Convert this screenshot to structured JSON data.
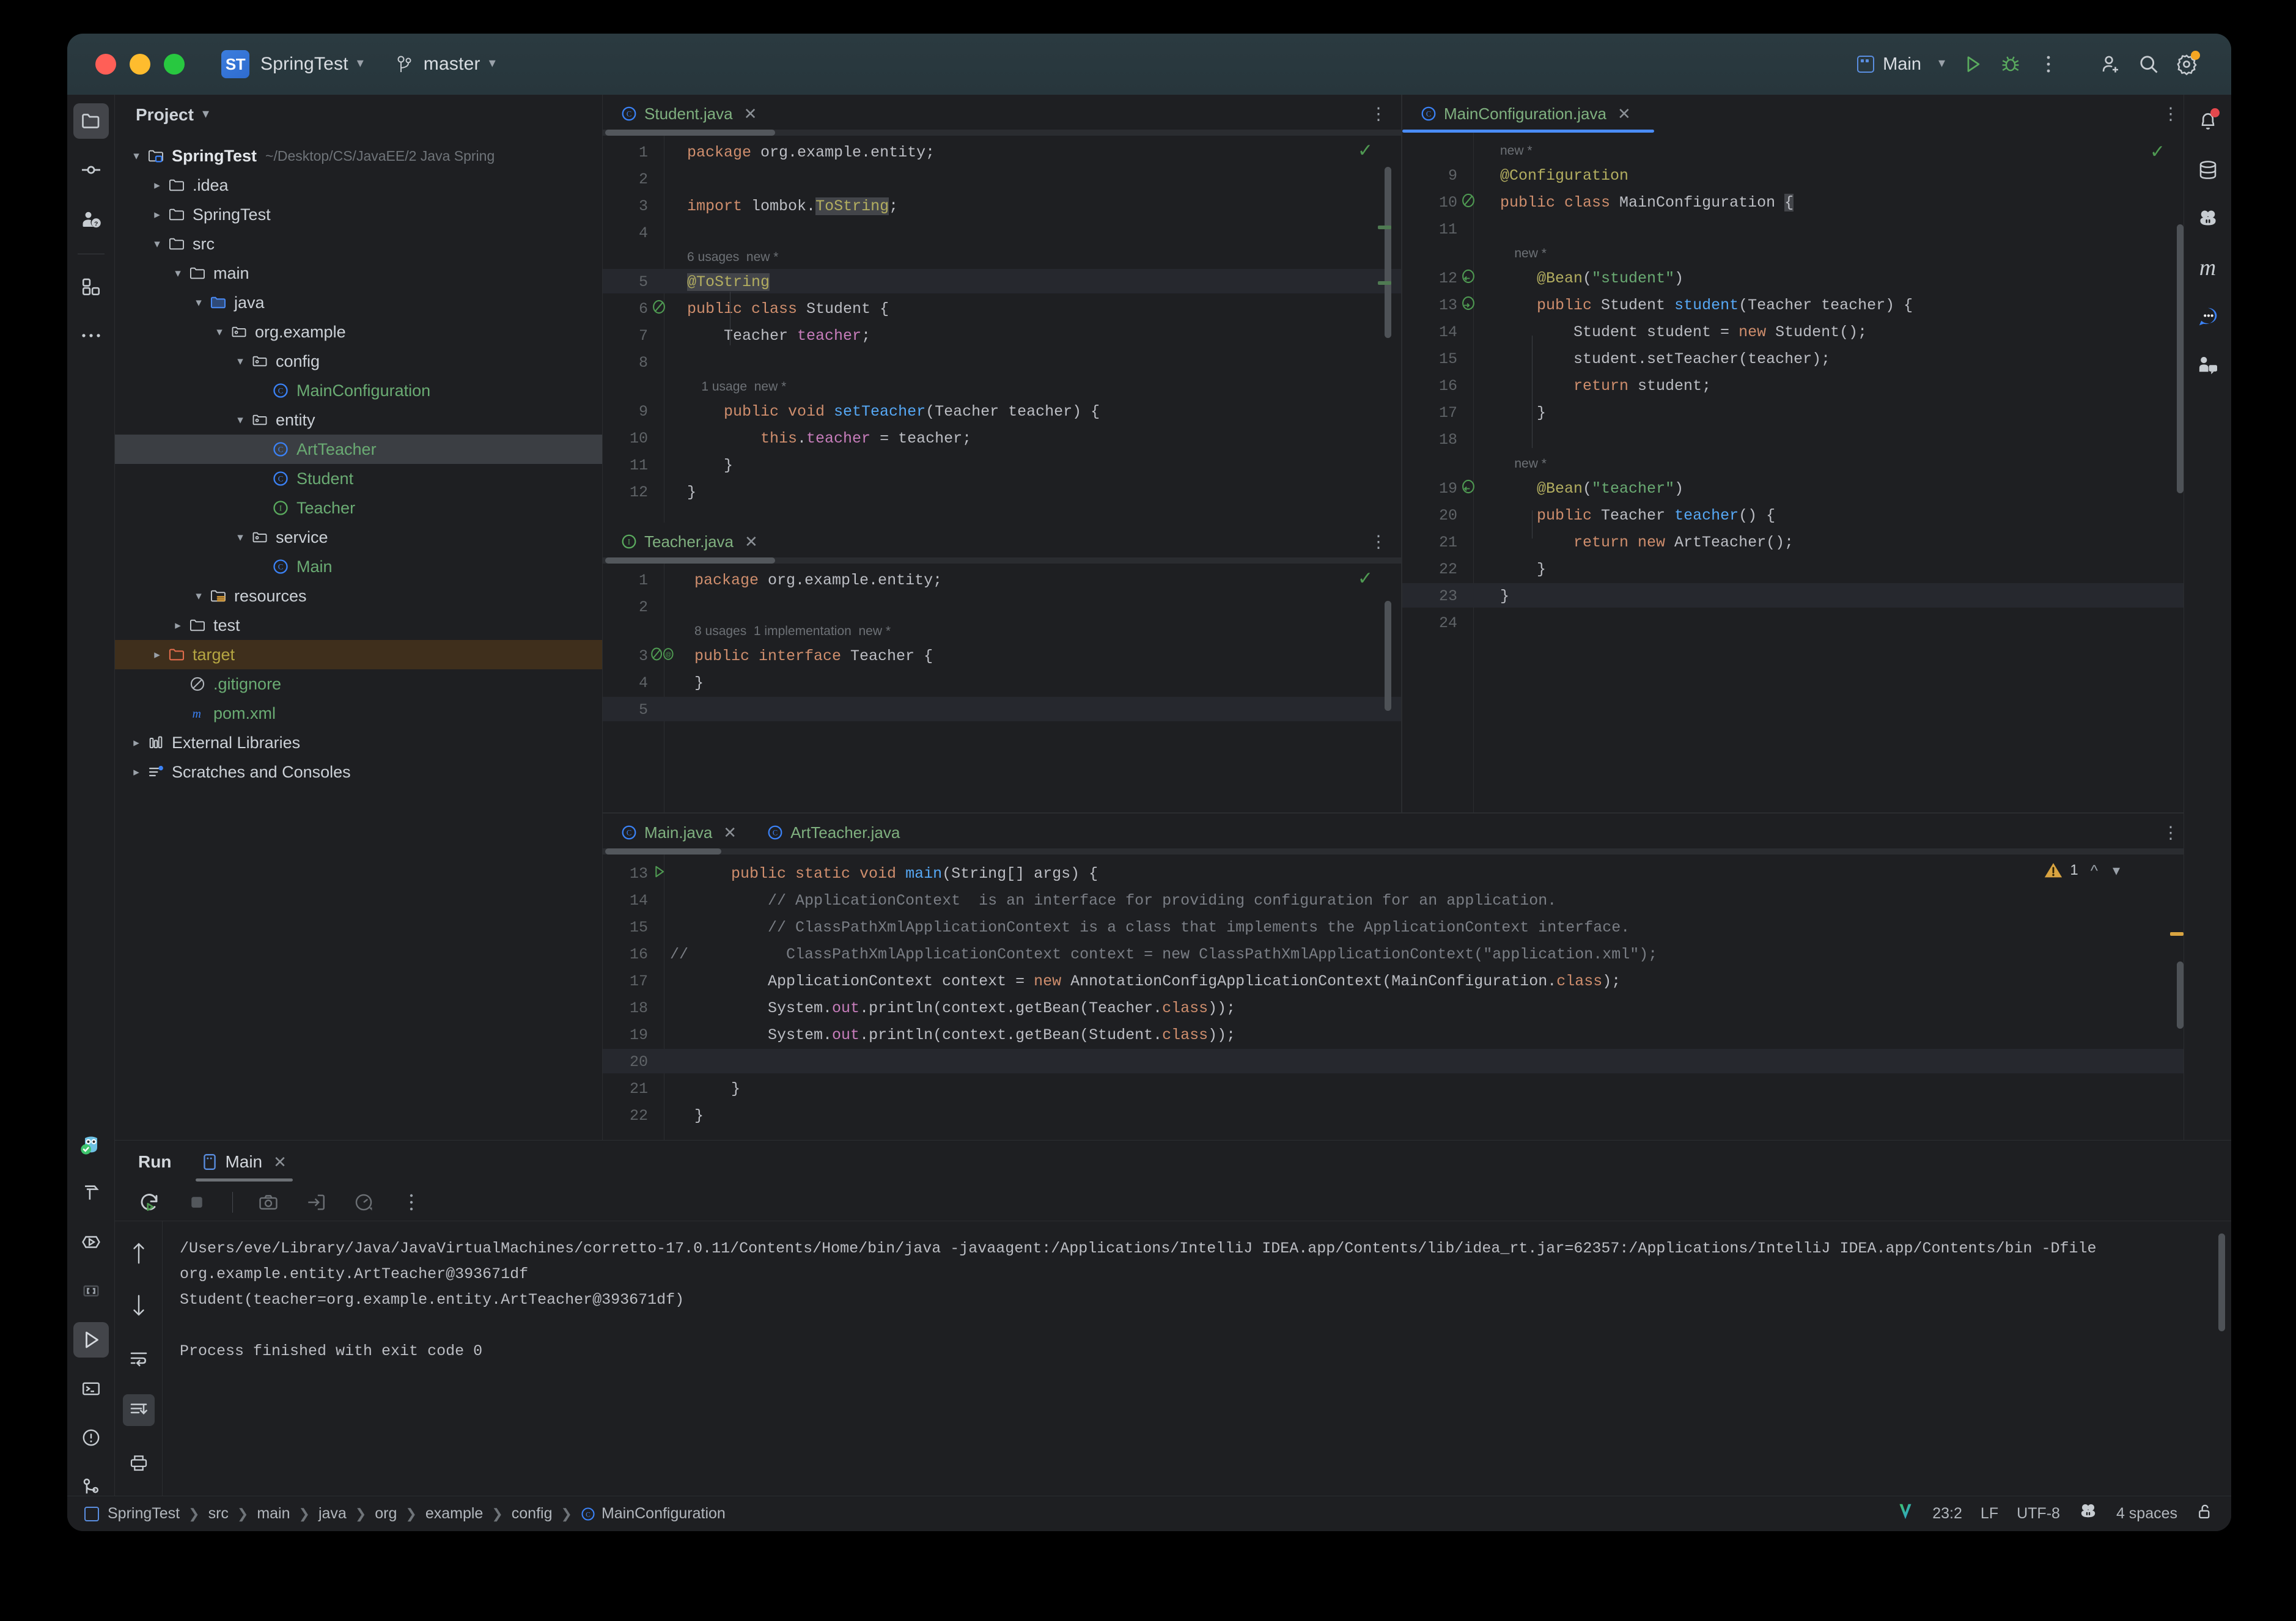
{
  "titlebar": {
    "project_badge": "ST",
    "project_name": "SpringTest",
    "branch": "master",
    "run_config": "Main",
    "icons": [
      "run-icon",
      "debug-icon",
      "more-options-icon",
      "add-user-icon",
      "search-icon",
      "settings-icon"
    ]
  },
  "project_panel": {
    "title": "Project",
    "tree": [
      {
        "label": "SpringTest",
        "path": "~/Desktop/CS/JavaEE/2 Java Spring",
        "depth": 0,
        "arrow": "down",
        "icon": "module-folder-icon",
        "style": "bold"
      },
      {
        "label": ".idea",
        "depth": 1,
        "arrow": "right",
        "icon": "folder-icon",
        "style": ""
      },
      {
        "label": "SpringTest",
        "depth": 1,
        "arrow": "right",
        "icon": "folder-icon",
        "style": ""
      },
      {
        "label": "src",
        "depth": 1,
        "arrow": "down",
        "icon": "folder-icon",
        "style": ""
      },
      {
        "label": "main",
        "depth": 2,
        "arrow": "down",
        "icon": "folder-icon",
        "style": ""
      },
      {
        "label": "java",
        "depth": 3,
        "arrow": "down",
        "icon": "source-folder-icon",
        "style": ""
      },
      {
        "label": "org.example",
        "depth": 4,
        "arrow": "down",
        "icon": "package-icon",
        "style": ""
      },
      {
        "label": "config",
        "depth": 5,
        "arrow": "down",
        "icon": "package-icon",
        "style": ""
      },
      {
        "label": "MainConfiguration",
        "depth": 6,
        "arrow": "",
        "icon": "class-icon",
        "style": "green"
      },
      {
        "label": "entity",
        "depth": 5,
        "arrow": "down",
        "icon": "package-icon",
        "style": ""
      },
      {
        "label": "ArtTeacher",
        "depth": 6,
        "arrow": "",
        "icon": "class-icon",
        "style": "green",
        "selected": true
      },
      {
        "label": "Student",
        "depth": 6,
        "arrow": "",
        "icon": "class-icon",
        "style": "green"
      },
      {
        "label": "Teacher",
        "depth": 6,
        "arrow": "",
        "icon": "interface-icon",
        "style": "green"
      },
      {
        "label": "service",
        "depth": 5,
        "arrow": "down",
        "icon": "package-icon",
        "style": ""
      },
      {
        "label": "Main",
        "depth": 6,
        "arrow": "",
        "icon": "class-icon",
        "style": "green"
      },
      {
        "label": "resources",
        "depth": 3,
        "arrow": "down",
        "icon": "resources-folder-icon",
        "style": ""
      },
      {
        "label": "test",
        "depth": 2,
        "arrow": "right",
        "icon": "folder-icon",
        "style": ""
      },
      {
        "label": "target",
        "depth": 1,
        "arrow": "right",
        "icon": "excluded-folder-icon",
        "style": "olive",
        "highlighted": true
      },
      {
        "label": ".gitignore",
        "depth": 2,
        "arrow": "",
        "icon": "gitignore-icon",
        "style": "green"
      },
      {
        "label": "pom.xml",
        "depth": 2,
        "arrow": "",
        "icon": "maven-icon",
        "style": "green"
      },
      {
        "label": "External Libraries",
        "depth": 0,
        "arrow": "right",
        "icon": "library-icon",
        "style": ""
      },
      {
        "label": "Scratches and Consoles",
        "depth": 0,
        "arrow": "right",
        "icon": "scratches-icon",
        "style": ""
      }
    ]
  },
  "editors": {
    "student": {
      "tab": {
        "label": "Student.java",
        "icon": "class-icon",
        "closable": true
      },
      "lines": [
        {
          "n": "1",
          "segments": [
            {
              "t": "package ",
              "c": "k-kw"
            },
            {
              "t": "org.example.entity;",
              "c": "k-txt"
            }
          ]
        },
        {
          "n": "2",
          "segments": []
        },
        {
          "n": "3",
          "segments": [
            {
              "t": "import ",
              "c": "k-kw"
            },
            {
              "t": "lombok.",
              "c": "k-txt"
            },
            {
              "t": "ToString",
              "c": "k-anno k-hl"
            },
            {
              "t": ";",
              "c": "k-txt"
            }
          ]
        },
        {
          "n": "4",
          "segments": []
        },
        {
          "n": "5",
          "segments": [
            {
              "t": "@ToString",
              "c": "k-anno k-hl"
            }
          ],
          "hint": "6 usages  new *",
          "current": true
        },
        {
          "n": "6",
          "segments": [
            {
              "t": "public class ",
              "c": "k-kw"
            },
            {
              "t": "Student ",
              "c": "k-txt"
            },
            {
              "t": "{",
              "c": "k-txt"
            }
          ],
          "marker": "lombok-icon"
        },
        {
          "n": "7",
          "segments": [
            {
              "t": "    Teacher ",
              "c": "k-txt"
            },
            {
              "t": "teacher",
              "c": "k-fld"
            },
            {
              "t": ";",
              "c": "k-txt"
            }
          ]
        },
        {
          "n": "8",
          "segments": []
        },
        {
          "n": "9",
          "segments": [
            {
              "t": "    public void ",
              "c": "k-kw"
            },
            {
              "t": "setTeacher",
              "c": "k-fn"
            },
            {
              "t": "(Teacher teacher) {",
              "c": "k-txt"
            }
          ],
          "hint": "    1 usage  new *"
        },
        {
          "n": "10",
          "segments": [
            {
              "t": "        this",
              "c": "k-kw"
            },
            {
              "t": ".",
              "c": "k-txt"
            },
            {
              "t": "teacher",
              "c": "k-fld"
            },
            {
              "t": " = teacher;",
              "c": "k-txt"
            }
          ]
        },
        {
          "n": "11",
          "segments": [
            {
              "t": "    }",
              "c": "k-txt"
            }
          ]
        },
        {
          "n": "12",
          "segments": [
            {
              "t": "}",
              "c": "k-txt"
            }
          ]
        }
      ]
    },
    "teacher": {
      "tab": {
        "label": "Teacher.java",
        "icon": "interface-icon",
        "closable": true
      },
      "lines": [
        {
          "n": "1",
          "segments": [
            {
              "t": "package ",
              "c": "k-kw"
            },
            {
              "t": "org.example.entity;",
              "c": "k-txt"
            }
          ]
        },
        {
          "n": "2",
          "segments": []
        },
        {
          "n": "3",
          "segments": [
            {
              "t": "public interface ",
              "c": "k-kw"
            },
            {
              "t": "Teacher {",
              "c": "k-txt"
            }
          ],
          "hint": "8 usages  1 implementation  new *",
          "marker": "lombok-impl-icon"
        },
        {
          "n": "4",
          "segments": [
            {
              "t": "}",
              "c": "k-txt"
            }
          ]
        },
        {
          "n": "5",
          "segments": [],
          "current": true
        }
      ]
    },
    "mainconfig": {
      "tab": {
        "label": "MainConfiguration.java",
        "icon": "class-icon",
        "closable": true
      },
      "lines": [
        {
          "n": "9",
          "segments": [
            {
              "t": "@Configuration",
              "c": "k-anno"
            }
          ],
          "hint": "new *"
        },
        {
          "n": "10",
          "segments": [
            {
              "t": "public class ",
              "c": "k-kw"
            },
            {
              "t": "MainConfiguration ",
              "c": "k-txt"
            },
            {
              "t": "{",
              "c": "k-txt k-hl"
            }
          ],
          "marker": "lombok-icon"
        },
        {
          "n": "11",
          "segments": []
        },
        {
          "n": "12",
          "segments": [
            {
              "t": "    @Bean",
              "c": "k-anno"
            },
            {
              "t": "(",
              "c": "k-txt"
            },
            {
              "t": "\"student\"",
              "c": "k-str"
            },
            {
              "t": ")",
              "c": "k-txt"
            }
          ],
          "hint": "    new *",
          "marker": "bean-in-icon"
        },
        {
          "n": "13",
          "segments": [
            {
              "t": "    public ",
              "c": "k-kw"
            },
            {
              "t": "Student ",
              "c": "k-txt"
            },
            {
              "t": "student",
              "c": "k-fn"
            },
            {
              "t": "(Teacher teacher) {",
              "c": "k-txt"
            }
          ],
          "marker": "bean-out-icon"
        },
        {
          "n": "14",
          "segments": [
            {
              "t": "        Student student = ",
              "c": "k-txt"
            },
            {
              "t": "new ",
              "c": "k-kw"
            },
            {
              "t": "Student();",
              "c": "k-txt"
            }
          ]
        },
        {
          "n": "15",
          "segments": [
            {
              "t": "        student.setTeacher(teacher);",
              "c": "k-txt"
            }
          ]
        },
        {
          "n": "16",
          "segments": [
            {
              "t": "        return ",
              "c": "k-kw"
            },
            {
              "t": "student;",
              "c": "k-txt"
            }
          ]
        },
        {
          "n": "17",
          "segments": [
            {
              "t": "    }",
              "c": "k-txt"
            }
          ]
        },
        {
          "n": "18",
          "segments": []
        },
        {
          "n": "19",
          "segments": [
            {
              "t": "    @Bean",
              "c": "k-anno"
            },
            {
              "t": "(",
              "c": "k-txt"
            },
            {
              "t": "\"teacher\"",
              "c": "k-str"
            },
            {
              "t": ")",
              "c": "k-txt"
            }
          ],
          "hint": "    new *",
          "marker": "bean-in-icon"
        },
        {
          "n": "20",
          "segments": [
            {
              "t": "    public ",
              "c": "k-kw"
            },
            {
              "t": "Teacher ",
              "c": "k-txt"
            },
            {
              "t": "teacher",
              "c": "k-fn"
            },
            {
              "t": "() {",
              "c": "k-txt"
            }
          ]
        },
        {
          "n": "21",
          "segments": [
            {
              "t": "        return new ",
              "c": "k-kw"
            },
            {
              "t": "ArtTeacher();",
              "c": "k-txt"
            }
          ]
        },
        {
          "n": "22",
          "segments": [
            {
              "t": "    }",
              "c": "k-txt"
            }
          ]
        },
        {
          "n": "23",
          "segments": [
            {
              "t": "}",
              "c": "k-txt"
            }
          ],
          "current": true
        },
        {
          "n": "24",
          "segments": []
        }
      ]
    },
    "main": {
      "tabs": [
        {
          "label": "Main.java",
          "icon": "class-icon",
          "closable": true,
          "active": true
        },
        {
          "label": "ArtTeacher.java",
          "icon": "class-icon",
          "closable": false,
          "active": false
        }
      ],
      "warning_count": "1",
      "lines": [
        {
          "n": "13",
          "segments": [
            {
              "t": "    public static void ",
              "c": "k-kw"
            },
            {
              "t": "main",
              "c": "k-fn"
            },
            {
              "t": "(String[] args) {",
              "c": "k-txt"
            }
          ],
          "marker": "run-gutter-icon"
        },
        {
          "n": "14",
          "segments": [
            {
              "t": "        // ApplicationContext  is an interface for providing configuration for an application.",
              "c": "k-com"
            }
          ]
        },
        {
          "n": "15",
          "segments": [
            {
              "t": "        // ClassPathXmlApplicationContext is a class that implements the ApplicationContext interface.",
              "c": "k-com"
            }
          ]
        },
        {
          "n": "16",
          "segments": [
            {
              "t": "          ClassPathXmlApplicationContext context = new ClassPathXmlApplicationContext(\"application.xml\");",
              "c": "k-com"
            }
          ],
          "commentmark": "//"
        },
        {
          "n": "17",
          "segments": [
            {
              "t": "        ApplicationContext context = ",
              "c": "k-txt"
            },
            {
              "t": "new ",
              "c": "k-kw"
            },
            {
              "t": "AnnotationConfigApplicationContext(MainConfiguration.",
              "c": "k-txt"
            },
            {
              "t": "class",
              "c": "k-kw"
            },
            {
              "t": ");",
              "c": "k-txt"
            }
          ]
        },
        {
          "n": "18",
          "segments": [
            {
              "t": "        System.",
              "c": "k-txt"
            },
            {
              "t": "out",
              "c": "k-fld"
            },
            {
              "t": ".println(context.getBean(Teacher.",
              "c": "k-txt"
            },
            {
              "t": "class",
              "c": "k-kw"
            },
            {
              "t": "));",
              "c": "k-txt"
            }
          ]
        },
        {
          "n": "19",
          "segments": [
            {
              "t": "        System.",
              "c": "k-txt"
            },
            {
              "t": "out",
              "c": "k-fld"
            },
            {
              "t": ".println(context.getBean(Student.",
              "c": "k-txt"
            },
            {
              "t": "class",
              "c": "k-kw"
            },
            {
              "t": "));",
              "c": "k-txt"
            }
          ]
        },
        {
          "n": "20",
          "segments": [],
          "current": true
        },
        {
          "n": "21",
          "segments": [
            {
              "t": "    }",
              "c": "k-txt"
            }
          ]
        },
        {
          "n": "22",
          "segments": [
            {
              "t": "}",
              "c": "k-txt"
            }
          ]
        }
      ]
    }
  },
  "run_panel": {
    "title": "Run",
    "tab": {
      "label": "Main",
      "icon": "run-config-icon"
    },
    "toolbar_icons": [
      "rerun-icon",
      "stop-icon",
      "camera-icon",
      "export-icon",
      "profiler-icon",
      "more-options-icon"
    ],
    "side_icons": [
      "scroll-up-icon",
      "scroll-down-icon",
      "soft-wrap-icon",
      "scroll-to-end-icon",
      "print-icon",
      "trash-icon"
    ],
    "console": [
      "/Users/eve/Library/Java/JavaVirtualMachines/corretto-17.0.11/Contents/Home/bin/java -javaagent:/Applications/IntelliJ IDEA.app/Contents/lib/idea_rt.jar=62357:/Applications/IntelliJ IDEA.app/Contents/bin -Dfile",
      "org.example.entity.ArtTeacher@393671df",
      "Student(teacher=org.example.entity.ArtTeacher@393671df)",
      "",
      "Process finished with exit code 0"
    ]
  },
  "statusbar": {
    "breadcrumb": [
      "SpringTest",
      "src",
      "main",
      "java",
      "org",
      "example",
      "config",
      "MainConfiguration"
    ],
    "position": "23:2",
    "line_ending": "LF",
    "encoding": "UTF-8",
    "indent": "4 spaces",
    "icons": [
      "inspections-icon",
      "ai-assistant-icon",
      "lock-icon"
    ]
  },
  "left_strip_icons": [
    "project-icon",
    "commit-icon",
    "pull-requests-icon",
    "plugins-icon",
    "more-tool-windows-icon"
  ],
  "left_strip_bottom_icons": [
    "ai-owl-icon",
    "build-icon",
    "run-anything-icon",
    "bracket-icon",
    "run-tool-icon",
    "terminal-icon",
    "problems-icon",
    "version-control-icon"
  ],
  "right_strip_icons": [
    "notifications-icon",
    "database-icon",
    "ai-assistant-icon",
    "maven-icon",
    "chat-icon",
    "code-with-me-icon"
  ],
  "colors": {
    "accent": "#4a8cf7",
    "green": "#6aab73",
    "keyword": "#cf8e6d",
    "annotation": "#b3ae60",
    "method": "#56a8f5",
    "field": "#c77dbb",
    "comment": "#7a7e85",
    "warning": "#d9a441",
    "editor_bg": "#1e1f22",
    "titlebar_bg": "#2b3a40"
  }
}
